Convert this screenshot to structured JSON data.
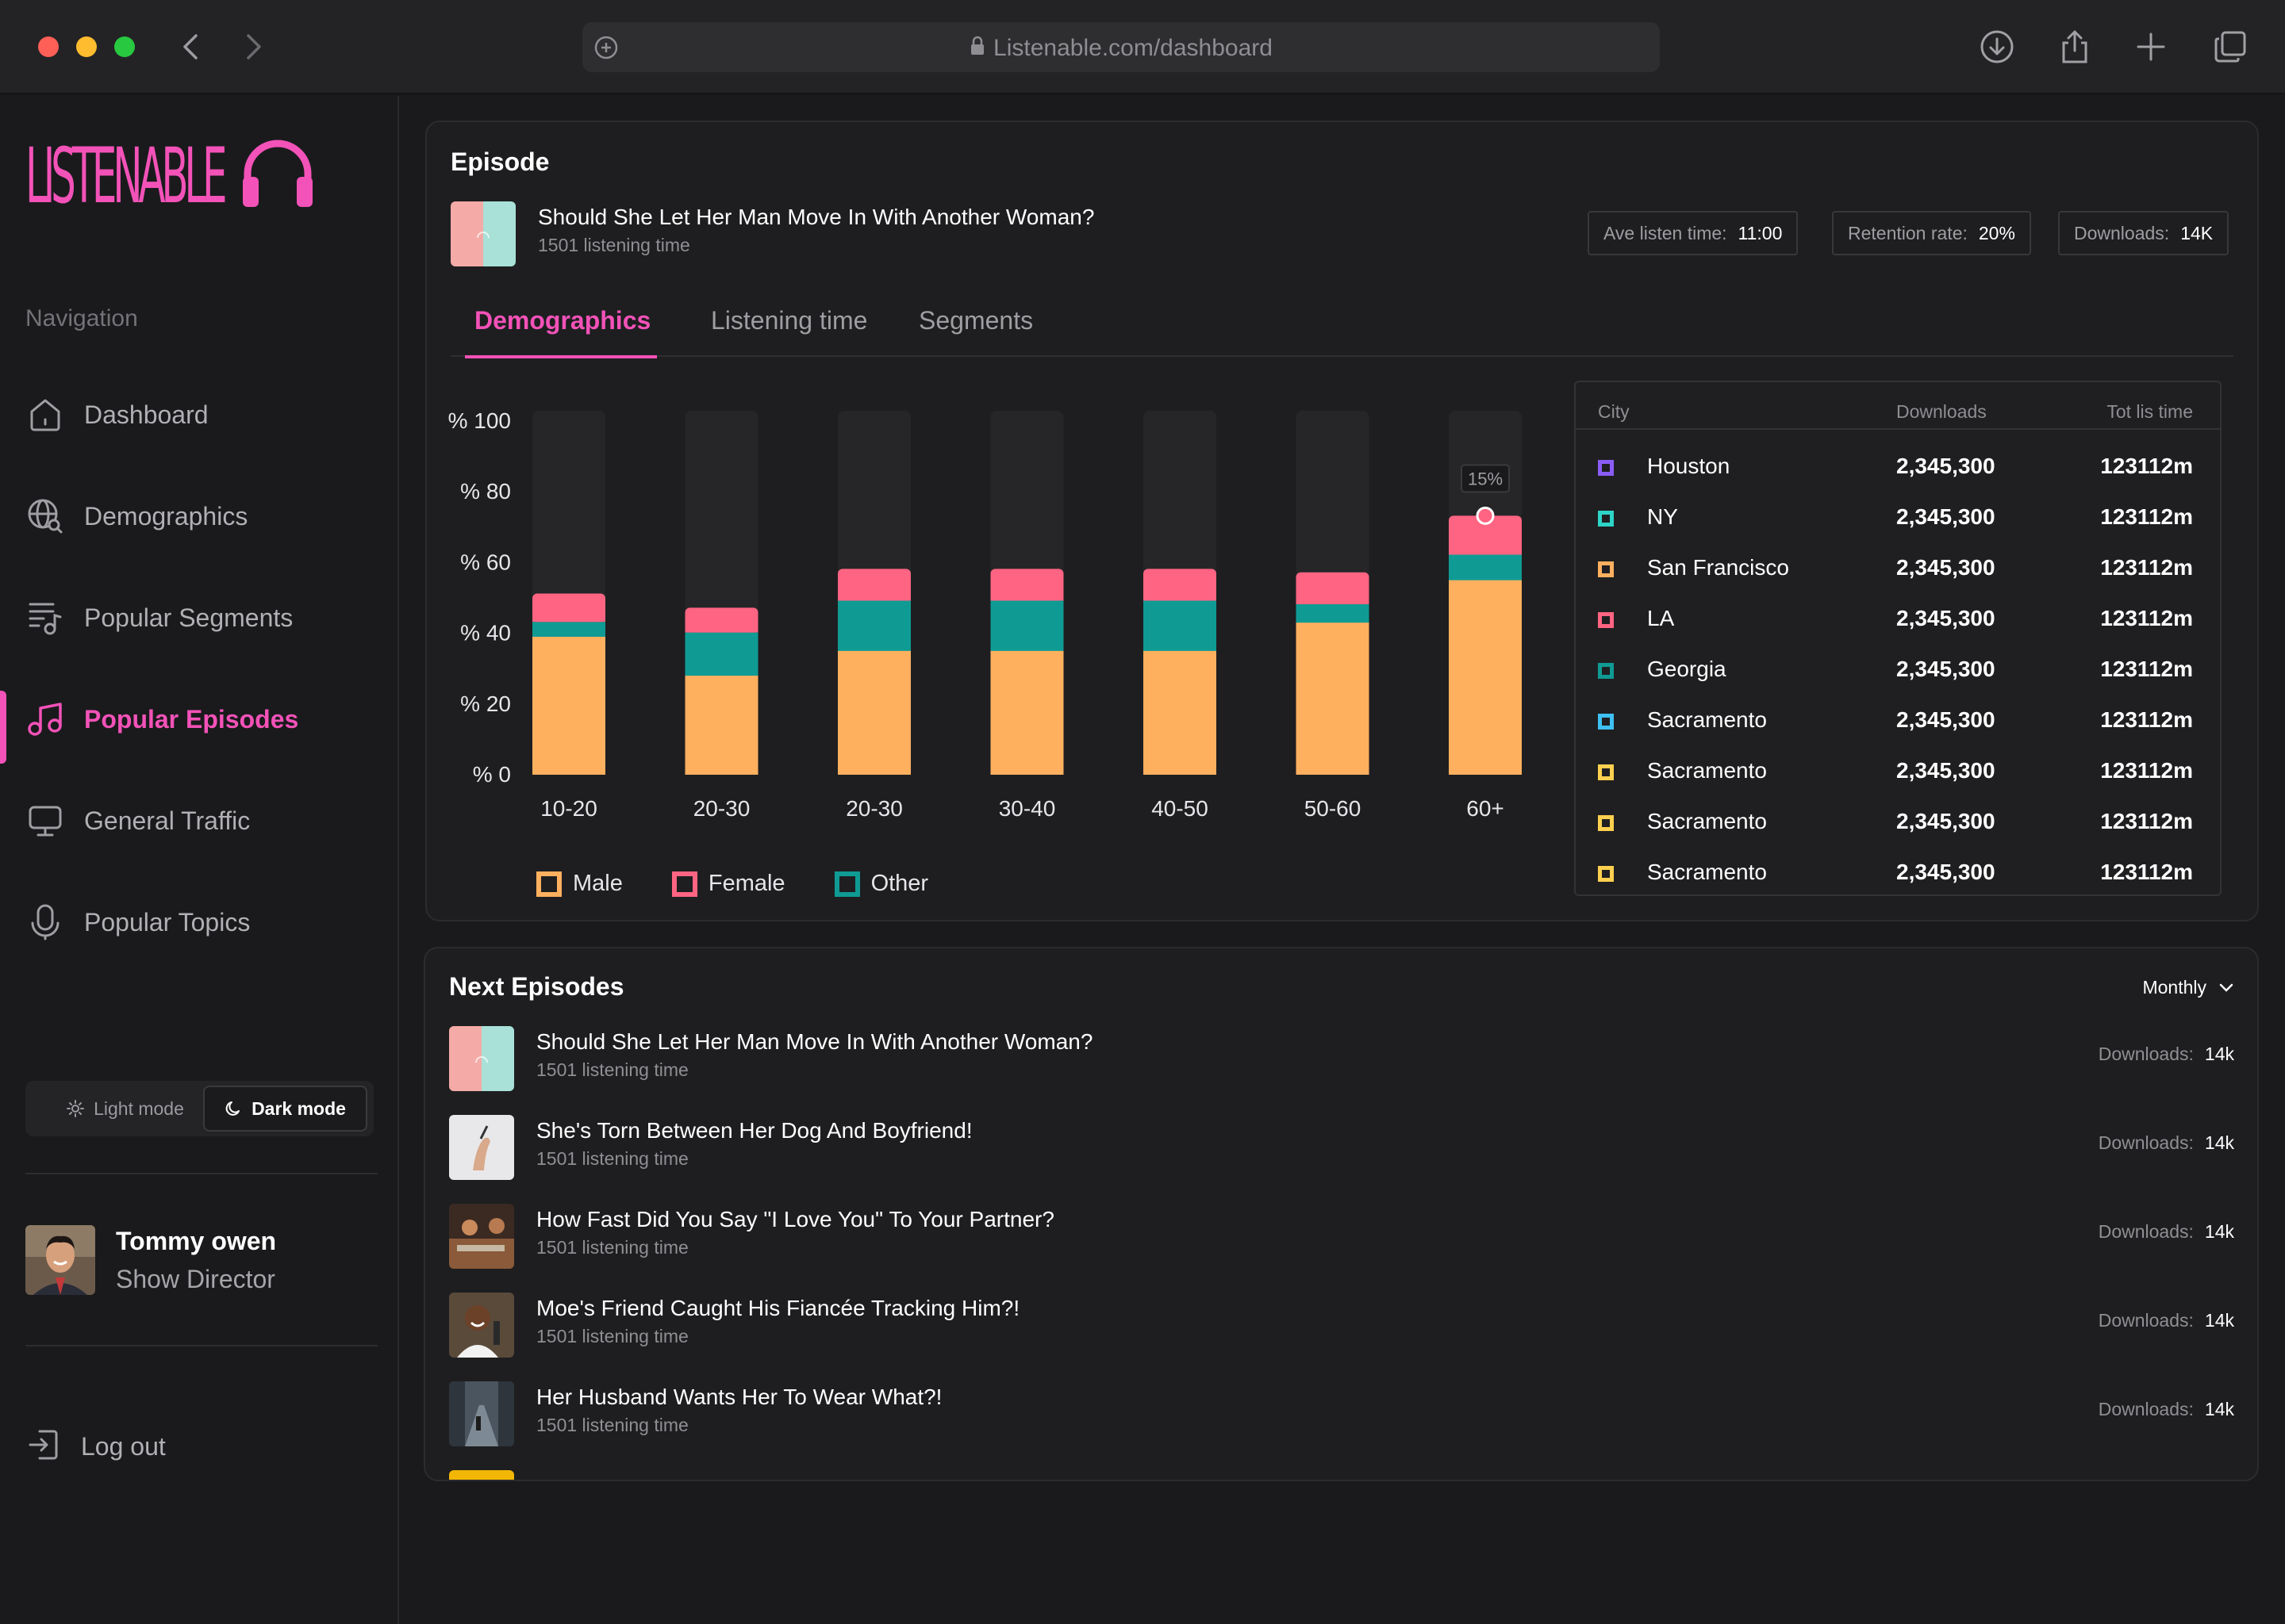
{
  "browser": {
    "url": "Listenable.com/dashboard"
  },
  "brand": {
    "logo_text": "LISTENABLE",
    "accent": "#f352b8"
  },
  "sidebar": {
    "nav_title": "Navigation",
    "items": [
      {
        "label": "Dashboard",
        "icon": "home-icon"
      },
      {
        "label": "Demographics",
        "icon": "globe-search-icon"
      },
      {
        "label": "Popular Segments",
        "icon": "playlist-icon"
      },
      {
        "label": "Popular Episodes",
        "icon": "music-note-icon",
        "active": true
      },
      {
        "label": "General Traffic",
        "icon": "monitor-icon"
      },
      {
        "label": "Popular Topics",
        "icon": "microphone-icon"
      }
    ],
    "mode_light": "Light mode",
    "mode_dark": "Dark mode",
    "user_name": "Tommy owen",
    "user_role": "Show Director",
    "logout": "Log out"
  },
  "episode": {
    "section_title": "Episode",
    "title": "Should She Let Her Man Move In With Another Woman?",
    "subtitle": "1501 listening time",
    "stats": [
      {
        "label": "Ave listen time:",
        "value": "11:00"
      },
      {
        "label": "Retention rate:",
        "value": "20%"
      },
      {
        "label": "Downloads:",
        "value": "14K"
      }
    ],
    "tabs": [
      "Demographics",
      "Listening time",
      "Segments"
    ]
  },
  "chart_data": {
    "type": "bar",
    "stacked": true,
    "categories": [
      "10-20",
      "20-30",
      "20-30",
      "30-40",
      "40-50",
      "50-60",
      "60+"
    ],
    "y_ticks": [
      "% 100",
      "% 80",
      "% 60",
      "% 40",
      "% 20",
      "% 0"
    ],
    "ylim": [
      0,
      100
    ],
    "series": [
      {
        "name": "Male",
        "color": "#ffb05f",
        "values": [
          39,
          28,
          35,
          35,
          35,
          43,
          55
        ]
      },
      {
        "name": "Other",
        "color": "#0f9b94",
        "values": [
          4,
          12,
          14,
          14,
          14,
          5,
          7
        ]
      },
      {
        "name": "Female",
        "color": "#ff6482",
        "values": [
          8,
          7,
          9,
          9,
          9,
          9,
          11
        ]
      }
    ],
    "annotation": {
      "category_index": 6,
      "label": "15%"
    },
    "grid": false,
    "legend_position": "bottom-left"
  },
  "city_table": {
    "headers": [
      "City",
      "Downloads",
      "Tot lis time"
    ],
    "rows": [
      {
        "city": "Houston",
        "downloads": "2,345,300",
        "time": "123112m",
        "color": "#8a5cf6"
      },
      {
        "city": "NY",
        "downloads": "2,345,300",
        "time": "123112m",
        "color": "#2dd4c8"
      },
      {
        "city": "San Francisco",
        "downloads": "2,345,300",
        "time": "123112m",
        "color": "#ffb05f"
      },
      {
        "city": "LA",
        "downloads": "2,345,300",
        "time": "123112m",
        "color": "#ff6482"
      },
      {
        "city": "Georgia",
        "downloads": "2,345,300",
        "time": "123112m",
        "color": "#0f9b94"
      },
      {
        "city": "Sacramento",
        "downloads": "2,345,300",
        "time": "123112m",
        "color": "#3ec0f2"
      },
      {
        "city": "Sacramento",
        "downloads": "2,345,300",
        "time": "123112m",
        "color": "#ffd04f"
      },
      {
        "city": "Sacramento",
        "downloads": "2,345,300",
        "time": "123112m",
        "color": "#ffd04f"
      },
      {
        "city": "Sacramento",
        "downloads": "2,345,300",
        "time": "123112m",
        "color": "#ffd04f"
      }
    ]
  },
  "next_episodes": {
    "title": "Next Episodes",
    "period": "Monthly",
    "download_label": "Downloads:",
    "items": [
      {
        "title": "Should She Let Her Man Move In With Another Woman?",
        "subtitle": "1501 listening time",
        "downloads": "14k"
      },
      {
        "title": "She's Torn Between Her Dog And Boyfriend!",
        "subtitle": "1501 listening time",
        "downloads": "14k"
      },
      {
        "title": "How Fast Did You Say \"I Love You\" To Your Partner?",
        "subtitle": "1501 listening time",
        "downloads": "14k"
      },
      {
        "title": "Moe's Friend Caught His Fiancée Tracking Him?!",
        "subtitle": "1501 listening time",
        "downloads": "14k"
      },
      {
        "title": "Her Husband Wants Her To Wear What?!",
        "subtitle": "1501 listening time",
        "downloads": "14k"
      }
    ]
  }
}
